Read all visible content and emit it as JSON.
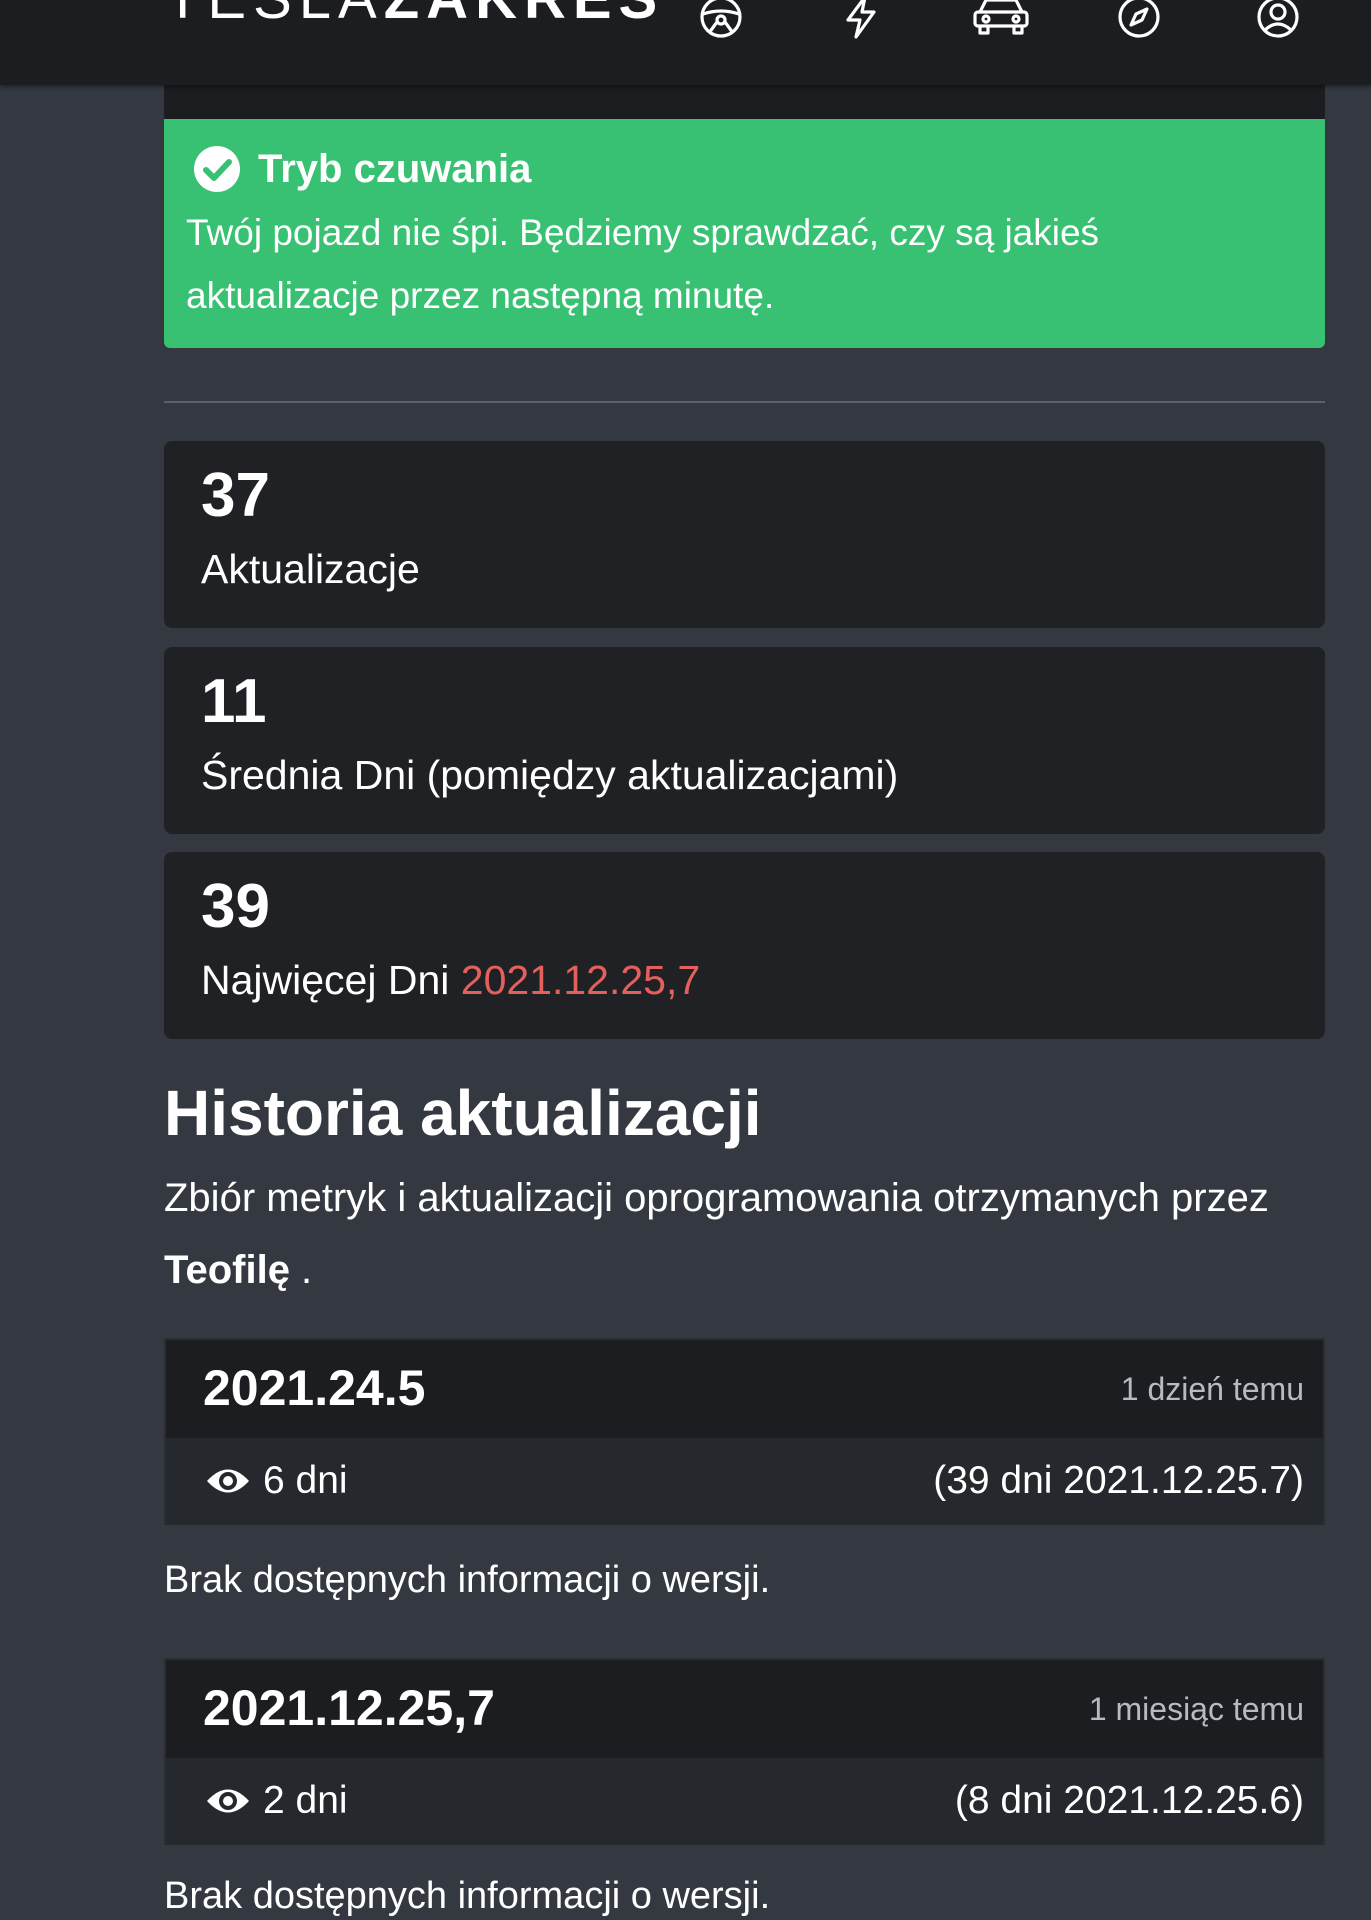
{
  "nav": {
    "logo_light": "TESLA",
    "logo_bold": "ZAKRES",
    "icons": [
      "steering-wheel-icon",
      "lightning-icon",
      "car-icon",
      "compass-icon",
      "user-icon"
    ]
  },
  "alert": {
    "icon": "check-circle-icon",
    "title": "Tryb czuwania",
    "message": "Twój pojazd nie śpi. Będziemy sprawdzać, czy są jakieś aktualizacje przez następną minutę.",
    "color": "#38c172"
  },
  "stats": [
    {
      "value": "37",
      "label": "Aktualizacje"
    },
    {
      "value": "11",
      "label": "Średnia Dni (pomiędzy aktualizacjami)"
    },
    {
      "value": "39",
      "label": "Najwięcej Dni",
      "highlight": "2021.12.25,7",
      "highlight_color": "#e3605c"
    }
  ],
  "history": {
    "title": "Historia aktualizacji",
    "description": "Zbiór metryk i aktualizacji oprogramowania otrzymanych przez",
    "owner": "Teofilę",
    "suffix": " ."
  },
  "updates": [
    {
      "version": "2021.24.5",
      "ago": "1 dzień temu",
      "days": "6 dni",
      "previous": "(39 dni 2021.12.25.7)",
      "note": "Brak dostępnych informacji o wersji."
    },
    {
      "version": "2021.12.25,7",
      "ago": "1 miesiąc temu",
      "days": "2 dni",
      "previous": "(8 dni 2021.12.25.6)",
      "note": "Brak dostępnych informacji o wersji."
    }
  ]
}
